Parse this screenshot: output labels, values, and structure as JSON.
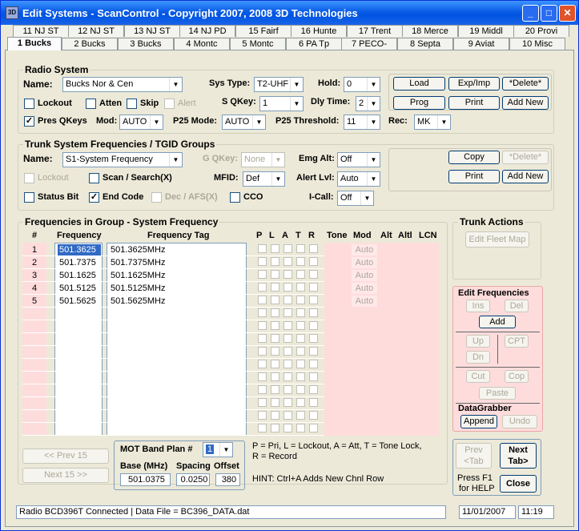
{
  "window": {
    "title": "Edit Systems - ScanControl - Copyright 2007, 2008 3D Technologies"
  },
  "tabs_row1": [
    "11 NJ ST",
    "12 NJ ST",
    "13 NJ ST",
    "14 NJ PD",
    "15 Fairf",
    "16 Hunte",
    "17 Trent",
    "18 Merce",
    "19 Middl",
    "20 Provi"
  ],
  "tabs_row2": [
    "1 Bucks",
    "2 Bucks",
    "3 Bucks",
    "4 Montc",
    "5 Montc",
    "6 PA Tp",
    "7 PECO-",
    "8 Septa",
    "9 Aviat",
    "10 Misc"
  ],
  "radio": {
    "title": "Radio System",
    "name_label": "Name:",
    "name_value": "Bucks Nor & Cen",
    "systype_label": "Sys Type:",
    "systype_value": "T2-UHF",
    "hold_label": "Hold:",
    "hold_value": "0",
    "lockout": "Lockout",
    "atten": "Atten",
    "skip": "Skip",
    "alert": "Alert",
    "sqkey_label": "S QKey:",
    "sqkey_value": "1",
    "dly_label": "Dly Time:",
    "dly_value": "2",
    "presq": "Pres QKeys",
    "mod_label": "Mod:",
    "mod_value": "AUTO",
    "p25mode_label": "P25 Mode:",
    "p25mode_value": "AUTO",
    "p25thr_label": "P25 Threshold:",
    "p25thr_value": "11",
    "rec_label": "Rec:",
    "rec_value": "MK",
    "btn_load": "Load",
    "btn_expimp": "Exp/Imp",
    "btn_delete": "*Delete*",
    "btn_prog": "Prog",
    "btn_print": "Print",
    "btn_addnew": "Add New"
  },
  "trunk": {
    "title": "Trunk System Frequencies / TGID Groups",
    "name_label": "Name:",
    "name_value": "S1-System Frequency",
    "gqkey_label": "G QKey:",
    "gqkey_value": "None",
    "emg_label": "Emg Alt:",
    "emg_value": "Off",
    "lockout": "Lockout",
    "scan": "Scan / Search(X)",
    "mfid_label": "MFID:",
    "mfid_value": "Def",
    "alertlvl_label": "Alert Lvl:",
    "alertlvl_value": "Auto",
    "statusbit": "Status Bit",
    "endcode": "End Code",
    "decafs": "Dec / AFS(X)",
    "cco": "CCO",
    "icall_label": "I-Call:",
    "icall_value": "Off",
    "btn_copy": "Copy",
    "btn_delete": "*Delete*",
    "btn_print": "Print",
    "btn_addnew": "Add New"
  },
  "freqs": {
    "title": "Frequencies in Group - System Frequency",
    "headers": {
      "num": "#",
      "freq": "Frequency",
      "tag": "Frequency Tag",
      "p": "P",
      "l": "L",
      "a": "A",
      "t": "T",
      "r": "R",
      "tone": "Tone",
      "mod": "Mod",
      "alt": "Alt",
      "altl": "Altl",
      "lcn": "LCN"
    },
    "rows": [
      {
        "num": "1",
        "freq": "501.3625",
        "tag": "501.3625MHz",
        "mod": "Auto"
      },
      {
        "num": "2",
        "freq": "501.7375",
        "tag": "501.7375MHz",
        "mod": "Auto"
      },
      {
        "num": "3",
        "freq": "501.1625",
        "tag": "501.1625MHz",
        "mod": "Auto"
      },
      {
        "num": "4",
        "freq": "501.5125",
        "tag": "501.5125MHz",
        "mod": "Auto"
      },
      {
        "num": "5",
        "freq": "501.5625",
        "tag": "501.5625MHz",
        "mod": "Auto"
      }
    ],
    "btn_prev": "<< Prev 15",
    "btn_next": "Next 15 >>",
    "motband_label": "MOT Band Plan #",
    "motband_value": "1",
    "base_label": "Base (MHz)",
    "base_value": "501.0375",
    "spacing_label": "Spacing",
    "spacing_value": "0.0250",
    "offset_label": "Offset",
    "offset_value": "380",
    "legend1": "P = Pri, L = Lockout, A = Att, T = Tone Lock,",
    "legend2": "R = Record",
    "hint": "HINT:  Ctrl+A Adds New Chnl Row"
  },
  "trunk_actions": {
    "title": "Trunk Actions",
    "btn_fleet": "Edit Fleet Map"
  },
  "edit_freqs": {
    "title": "Edit Frequencies",
    "ins": "Ins",
    "del": "Del",
    "add": "Add",
    "up": "Up",
    "dn": "Dn",
    "cpt": "CPT",
    "cut": "Cut",
    "cop": "Cop",
    "paste": "Paste",
    "grabber_title": "DataGrabber",
    "append": "Append",
    "undo": "Undo"
  },
  "nav": {
    "prev1": "Prev",
    "prev2": "<Tab",
    "next1": "Next",
    "next2": "Tab>",
    "help1": "Press F1",
    "help2": "for HELP",
    "close": "Close"
  },
  "status": {
    "text": "Radio BCD396T Connected | Data File = BC396_DATA.dat",
    "date": "11/01/2007",
    "time": "11:19"
  },
  "colors": {
    "accent_pink": "#ffcccc",
    "title_blue": "#0054e3",
    "selection": "#316ac5"
  }
}
